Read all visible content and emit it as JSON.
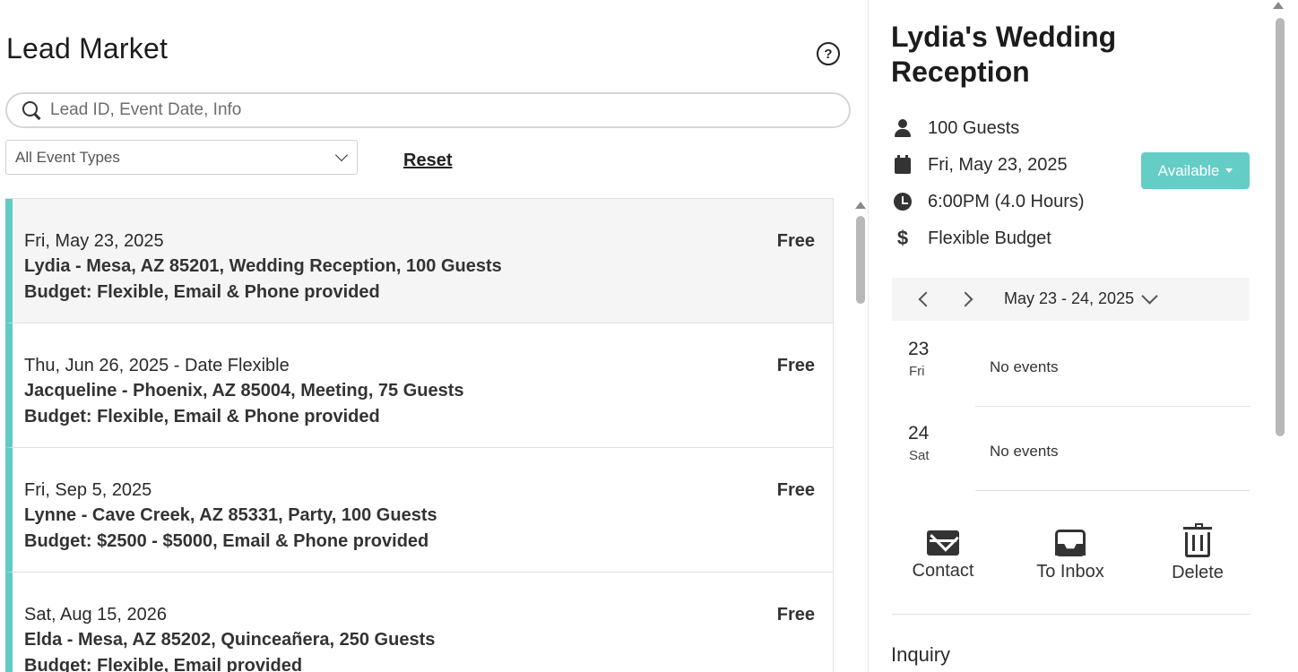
{
  "header": {
    "title": "Lead Market",
    "help_icon": "question-circle-icon"
  },
  "search": {
    "placeholder": "Lead ID, Event Date, Info",
    "value": ""
  },
  "filter": {
    "selected": "All Event Types"
  },
  "reset_label": "Reset",
  "leads": [
    {
      "date": "Fri, May 23, 2025",
      "info": "Lydia - Mesa, AZ 85201, Wedding Reception, 100 Guests",
      "details": "Budget: Flexible, Email & Phone provided",
      "price": "Free",
      "selected": true
    },
    {
      "date": "Thu, Jun 26, 2025 - Date Flexible",
      "info": "Jacqueline - Phoenix, AZ 85004, Meeting, 75 Guests",
      "details": "Budget: Flexible, Email & Phone provided",
      "price": "Free",
      "selected": false
    },
    {
      "date": "Fri, Sep 5, 2025",
      "info": "Lynne - Cave Creek, AZ 85331, Party, 100 Guests",
      "details": "Budget: $2500 - $5000, Email & Phone provided",
      "price": "Free",
      "selected": false
    },
    {
      "date": "Sat, Aug 15, 2026",
      "info": "Elda - Mesa, AZ 85202, Quinceañera, 250 Guests",
      "details": "Budget: Flexible, Email provided",
      "price": "Free",
      "selected": false
    }
  ],
  "detail": {
    "title": "Lydia's Wedding Reception",
    "guests": "100 Guests",
    "date": "Fri, May 23, 2025",
    "time": "6:00PM (4.0 Hours)",
    "budget": "Flexible Budget",
    "status_label": "Available",
    "accent_color": "#63cdc6",
    "calendar": {
      "range": "May 23 - 24, 2025",
      "days": [
        {
          "num": "23",
          "name": "Fri",
          "events": "No events"
        },
        {
          "num": "24",
          "name": "Sat",
          "events": "No events"
        }
      ]
    },
    "actions": {
      "contact": "Contact",
      "inbox": "To Inbox",
      "delete": "Delete"
    },
    "section_title": "Inquiry"
  }
}
